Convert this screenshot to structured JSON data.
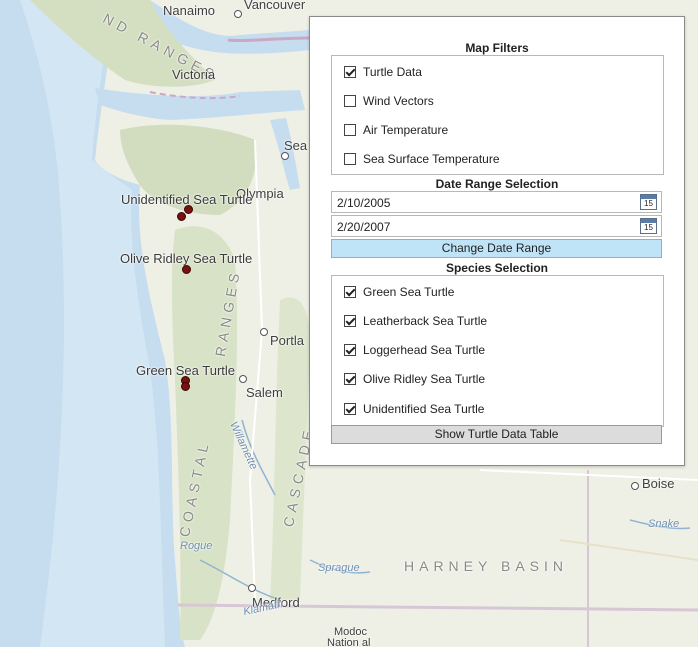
{
  "map": {
    "labels": {
      "nanaimo": "Nanaimo",
      "vancouver": "Vancouver",
      "victoria": "Victoria",
      "seattle": "Sea",
      "olympia": "Olympia",
      "portland": "Portla",
      "salem": "Salem",
      "medford": "Medford",
      "boise": "Boise",
      "modoc": "Modoc",
      "national": "Nation al",
      "harney_basin": "HARNEY BASIN",
      "coastal": "COASTAL",
      "cascade": "CASCADE",
      "ranges": "RANGES",
      "island_ranges": "ND RANGES",
      "willamette": "Willamette",
      "rogue": "Rogue",
      "sprague": "Sprague",
      "klamath": "Klamath",
      "snake": "Snake"
    },
    "turtle_labels": {
      "unidentified": "Unidentified Sea Turtle",
      "olive_ridley": "Olive Ridley Sea Turtle",
      "green": "Green Sea Turtle"
    }
  },
  "panel": {
    "map_filters_title": "Map Filters",
    "filters": [
      {
        "label": "Turtle Data",
        "checked": true
      },
      {
        "label": "Wind Vectors",
        "checked": false
      },
      {
        "label": "Air Temperature",
        "checked": false
      },
      {
        "label": "Sea Surface Temperature",
        "checked": false
      }
    ],
    "date_range_title": "Date Range Selection",
    "start_date": "2/10/2005",
    "end_date": "2/20/2007",
    "calendar_day": "15",
    "change_date_button": "Change Date Range",
    "species_title": "Species Selection",
    "species": [
      {
        "label": "Green Sea Turtle",
        "checked": true
      },
      {
        "label": "Leatherback Sea Turtle",
        "checked": true
      },
      {
        "label": "Loggerhead Sea Turtle",
        "checked": true
      },
      {
        "label": "Olive Ridley Sea Turtle",
        "checked": true
      },
      {
        "label": "Unidentified Sea Turtle",
        "checked": true
      }
    ],
    "show_table_button": "Show Turtle Data Table"
  },
  "colors": {
    "ocean": "#c7def0",
    "land": "#eef0e6",
    "marker": "#7a1010",
    "button_blue": "#bfe3f7"
  }
}
